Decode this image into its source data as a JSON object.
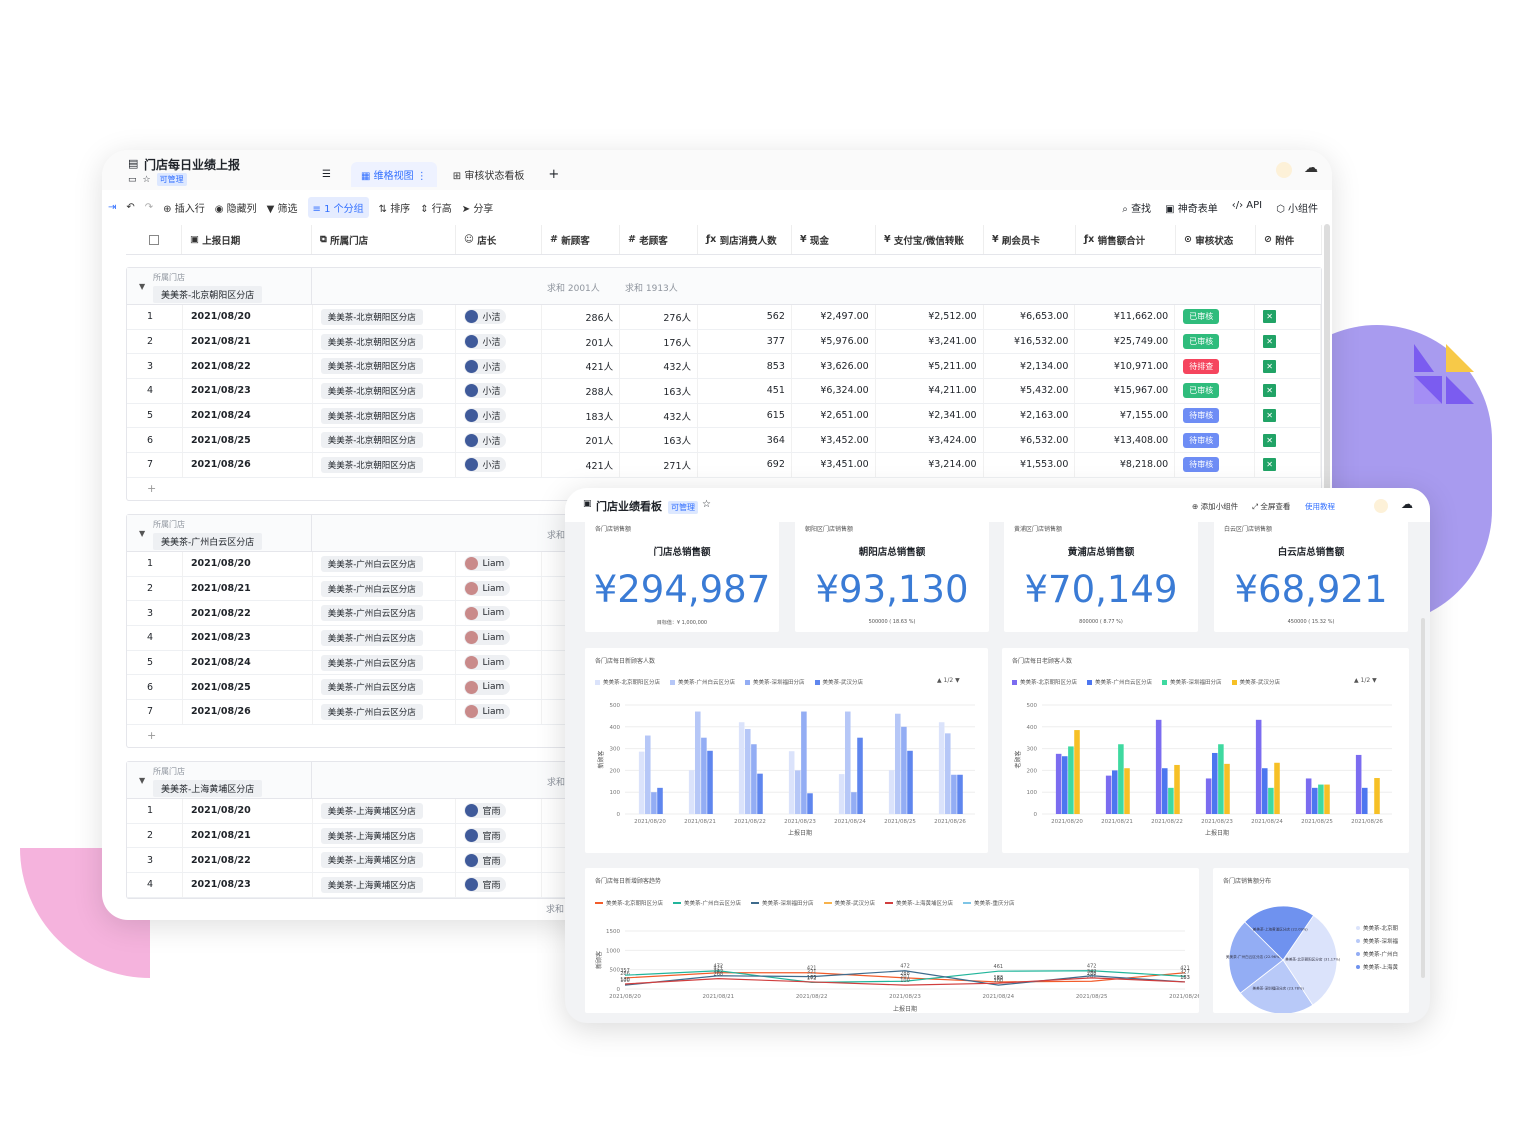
{
  "sheet": {
    "title": "门店每日业绩上报",
    "perm": "可管理",
    "tabs": [
      {
        "label": "维格视图"
      },
      {
        "label": "审核状态看板"
      }
    ],
    "toolbar": {
      "insert": "插入行",
      "hide": "隐藏列",
      "filter": "筛选",
      "group": "1 个分组",
      "sort": "排序",
      "rowheight": "行高",
      "share": "分享",
      "find": "查找",
      "form": "神奇表单",
      "api": "API",
      "widget": "小组件"
    },
    "columns": [
      "上报日期",
      "所属门店",
      "店长",
      "新顾客",
      "老顾客",
      "到店消费人数",
      "现金",
      "支付宝/微信转账",
      "刷会员卡",
      "销售额合计",
      "审核状态",
      "附件"
    ],
    "group_label": "所属门店",
    "groups": [
      {
        "store": "美美茶-北京朝阳区分店",
        "sum_new": "求和 2001人",
        "sum_old": "求和 1913人",
        "rows": [
          {
            "n": "1",
            "date": "2021/08/20",
            "store": "美美茶-北京朝阳区分店",
            "mgr": "小洁",
            "new": "286人",
            "old": "276人",
            "visits": "562",
            "cash": "¥2,497.00",
            "pay": "¥2,512.00",
            "card": "¥6,653.00",
            "total": "¥11,662.00",
            "status": "已审核"
          },
          {
            "n": "2",
            "date": "2021/08/21",
            "store": "美美茶-北京朝阳区分店",
            "mgr": "小洁",
            "new": "201人",
            "old": "176人",
            "visits": "377",
            "cash": "¥5,976.00",
            "pay": "¥3,241.00",
            "card": "¥16,532.00",
            "total": "¥25,749.00",
            "status": "已审核"
          },
          {
            "n": "3",
            "date": "2021/08/22",
            "store": "美美茶-北京朝阳区分店",
            "mgr": "小洁",
            "new": "421人",
            "old": "432人",
            "visits": "853",
            "cash": "¥3,626.00",
            "pay": "¥5,211.00",
            "card": "¥2,134.00",
            "total": "¥10,971.00",
            "status": "待排查"
          },
          {
            "n": "4",
            "date": "2021/08/23",
            "store": "美美茶-北京朝阳区分店",
            "mgr": "小洁",
            "new": "288人",
            "old": "163人",
            "visits": "451",
            "cash": "¥6,324.00",
            "pay": "¥4,211.00",
            "card": "¥5,432.00",
            "total": "¥15,967.00",
            "status": "已审核"
          },
          {
            "n": "5",
            "date": "2021/08/24",
            "store": "美美茶-北京朝阳区分店",
            "mgr": "小洁",
            "new": "183人",
            "old": "432人",
            "visits": "615",
            "cash": "¥2,651.00",
            "pay": "¥2,341.00",
            "card": "¥2,163.00",
            "total": "¥7,155.00",
            "status": "待审核"
          },
          {
            "n": "6",
            "date": "2021/08/25",
            "store": "美美茶-北京朝阳区分店",
            "mgr": "小洁",
            "new": "201人",
            "old": "163人",
            "visits": "364",
            "cash": "¥3,452.00",
            "pay": "¥3,424.00",
            "card": "¥6,532.00",
            "total": "¥13,408.00",
            "status": "待审核"
          },
          {
            "n": "7",
            "date": "2021/08/26",
            "store": "美美茶-北京朝阳区分店",
            "mgr": "小洁",
            "new": "421人",
            "old": "271人",
            "visits": "692",
            "cash": "¥3,451.00",
            "pay": "¥3,214.00",
            "card": "¥1,553.00",
            "total": "¥8,218.00",
            "status": "待审核"
          }
        ]
      },
      {
        "store": "美美茶-广州白云区分店",
        "sum_new": "求和",
        "rows": [
          {
            "n": "1",
            "date": "2021/08/20",
            "store": "美美茶-广州白云区分店",
            "mgr": "Liam"
          },
          {
            "n": "2",
            "date": "2021/08/21",
            "store": "美美茶-广州白云区分店",
            "mgr": "Liam"
          },
          {
            "n": "3",
            "date": "2021/08/22",
            "store": "美美茶-广州白云区分店",
            "mgr": "Liam"
          },
          {
            "n": "4",
            "date": "2021/08/23",
            "store": "美美茶-广州白云区分店",
            "mgr": "Liam"
          },
          {
            "n": "5",
            "date": "2021/08/24",
            "store": "美美茶-广州白云区分店",
            "mgr": "Liam"
          },
          {
            "n": "6",
            "date": "2021/08/25",
            "store": "美美茶-广州白云区分店",
            "mgr": "Liam"
          },
          {
            "n": "7",
            "date": "2021/08/26",
            "store": "美美茶-广州白云区分店",
            "mgr": "Liam"
          }
        ]
      },
      {
        "store": "美美茶-上海黄埔区分店",
        "sum_new": "求和",
        "rows": [
          {
            "n": "1",
            "date": "2021/08/20",
            "store": "美美茶-上海黄埔区分店",
            "mgr": "官雨"
          },
          {
            "n": "2",
            "date": "2021/08/21",
            "store": "美美茶-上海黄埔区分店",
            "mgr": "官雨"
          },
          {
            "n": "3",
            "date": "2021/08/22",
            "store": "美美茶-上海黄埔区分店",
            "mgr": "官雨"
          },
          {
            "n": "4",
            "date": "2021/08/23",
            "store": "美美茶-上海黄埔区分店",
            "mgr": "官雨"
          }
        ]
      }
    ],
    "footer_sum": "求和",
    "status_colors": {
      "已审核": "#2fbc7c",
      "待排查": "#f5455e",
      "待审核": "#6e8df5"
    }
  },
  "dashboard": {
    "title": "门店业绩看板",
    "perm": "可管理",
    "add_widget": "添加小组件",
    "fullscreen": "全屏查看",
    "tutorial": "使用教程",
    "kpis": [
      {
        "label": "各门店销售额",
        "title": "门店总销售额",
        "value": "¥294,987",
        "foot": "目标值：¥ 1,000,000"
      },
      {
        "label": "朝阳区门店销售额",
        "title": "朝阳店总销售额",
        "value": "¥93,130",
        "foot": "500000 ( 18.63 %)"
      },
      {
        "label": "黄浦区门店销售额",
        "title": "黄浦店总销售额",
        "value": "¥70,149",
        "foot": "800000 ( 8.77 %)"
      },
      {
        "label": "白云区门店销售额",
        "title": "白云店总销售额",
        "value": "¥68,921",
        "foot": "450000 ( 15.32 %)"
      }
    ],
    "pager": "1/2",
    "accent": "#3a7bd5"
  },
  "chart_data": [
    {
      "type": "bar",
      "title": "各门店每日新顾客人数",
      "xlabel": "上报日期",
      "ylabel": "新顾客",
      "ylim": [
        0,
        500
      ],
      "yticks": [
        "0",
        "100",
        "200",
        "300",
        "400",
        "500"
      ],
      "categories": [
        "2021/08/20",
        "2021/08/21",
        "2021/08/22",
        "2021/08/23",
        "2021/08/24",
        "2021/08/25",
        "2021/08/26"
      ],
      "series": [
        {
          "name": "美美茶-北京朝阳区分店",
          "color": "#dbe3fb",
          "values": [
            286,
            201,
            421,
            288,
            183,
            201,
            421
          ]
        },
        {
          "name": "美美茶-广州白云区分店",
          "color": "#b6c7f7",
          "values": [
            360,
            470,
            390,
            200,
            470,
            460,
            370
          ]
        },
        {
          "name": "美美茶-深圳福田分店",
          "color": "#93adf4",
          "values": [
            100,
            350,
            320,
            470,
            100,
            400,
            180
          ]
        },
        {
          "name": "美美茶-武汉分店",
          "color": "#5f86ee",
          "values": [
            120,
            290,
            185,
            95,
            350,
            290,
            180
          ]
        }
      ]
    },
    {
      "type": "bar",
      "title": "各门店每日老顾客人数",
      "xlabel": "上报日期",
      "ylabel": "老顾客",
      "ylim": [
        0,
        500
      ],
      "yticks": [
        "0",
        "100",
        "200",
        "300",
        "400",
        "500"
      ],
      "categories": [
        "2021/08/20",
        "2021/08/21",
        "2021/08/22",
        "2021/08/23",
        "2021/08/24",
        "2021/08/25",
        "2021/08/26"
      ],
      "series": [
        {
          "name": "美美茶-北京朝阳区分店",
          "color": "#7b6cf0",
          "values": [
            276,
            176,
            432,
            163,
            432,
            163,
            271
          ]
        },
        {
          "name": "美美茶-广州白云区分店",
          "color": "#4d76f0",
          "values": [
            265,
            200,
            210,
            280,
            210,
            120,
            120
          ]
        },
        {
          "name": "美美茶-深圳福田分店",
          "color": "#3fd9a0",
          "values": [
            310,
            320,
            120,
            320,
            120,
            135,
            0
          ]
        },
        {
          "name": "美美茶-武汉分店",
          "color": "#f6c026",
          "values": [
            385,
            210,
            225,
            230,
            235,
            135,
            165
          ]
        }
      ]
    },
    {
      "type": "line",
      "title": "各门店每日新增顾客趋势",
      "xlabel": "上报日期",
      "ylabel": "新顾客",
      "ylim": [
        0,
        1500
      ],
      "yticks": [
        "0",
        "500",
        "1000",
        "1500"
      ],
      "x": [
        "2021/08/20",
        "2021/08/21",
        "2021/08/22",
        "2021/08/23",
        "2021/08/24",
        "2021/08/25",
        "2021/08/26"
      ],
      "series": [
        {
          "name": "美美茶-北京朝阳区分店",
          "color": "#f25c2b",
          "values": [
            286,
            421,
            421,
            288,
            183,
            201,
            421
          ]
        },
        {
          "name": "美美茶-广州白云区分店",
          "color": "#22b59b",
          "values": [
            357,
            472,
            172,
            201,
            461,
            472,
            327
          ]
        },
        {
          "name": "美美茶-深圳福田分店",
          "color": "#3e6b8c",
          "values": [
            100,
            342,
            321,
            472,
            100,
            342,
            183
          ]
        },
        {
          "name": "美美茶-武汉分店",
          "color": "#f7b24c",
          "values": [
            0,
            0,
            0,
            0,
            0,
            0,
            0
          ]
        },
        {
          "name": "美美茶-上海黄埔区分店",
          "color": "#d13e3e",
          "values": [
            130,
            268,
            183,
            100,
            150,
            288,
            183
          ]
        },
        {
          "name": "美美茶-重庆分店",
          "color": "#7ec5e6",
          "values": [
            0,
            0,
            0,
            0,
            0,
            0,
            0
          ]
        }
      ],
      "labels": [
        "286",
        "472",
        "357",
        "100",
        "201",
        "342",
        "268",
        "421",
        "172",
        "321",
        "183",
        "288",
        "201",
        "472",
        "100",
        "183",
        "461",
        "100",
        "201",
        "472",
        "342",
        "288",
        "421",
        "327",
        "183"
      ]
    },
    {
      "type": "pie",
      "title": "各门店销售额分布",
      "slices": [
        {
          "name": "美美茶-北京朝阳区分店",
          "value": 31.17,
          "color": "#dbe3fb"
        },
        {
          "name": "美美茶-深圳福田分店",
          "value": 23.78,
          "color": "#b8c9f8"
        },
        {
          "name": "美美茶-广州白云区分店",
          "value": 22.96,
          "color": "#93adf4"
        },
        {
          "name": "美美茶-上海黄浦区分店",
          "value": 22.09,
          "color": "#6f92ef"
        }
      ],
      "slice_labels": [
        "美美茶-北京朝阳区分店 (31.17%)",
        "美美茶-深圳福田分店 (23.78%)",
        "美美茶-广州白云区分店 (22.96%)",
        "美美茶-上海黄浦区分店 (22.09%)"
      ],
      "legend": [
        "美美茶-北京朝",
        "美美茶-深圳福",
        "美美茶-广州白",
        "美美茶-上海黄"
      ]
    }
  ]
}
